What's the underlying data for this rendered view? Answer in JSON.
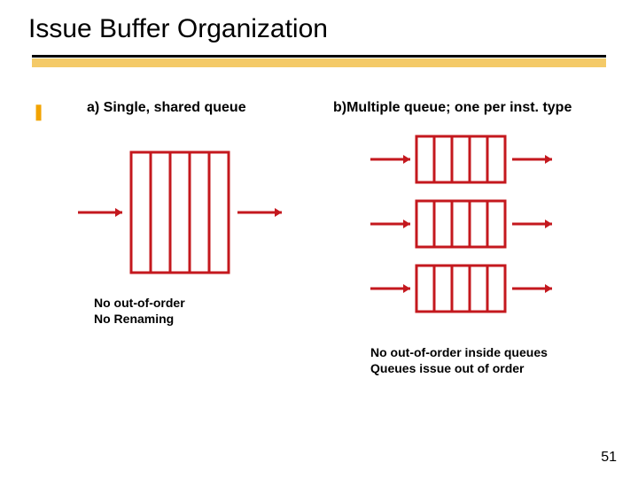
{
  "title": "Issue Buffer Organization",
  "bullet_glyph": "❚",
  "col_a": {
    "heading": "a) Single, shared queue",
    "caption_line1": "No out-of-order",
    "caption_line2": "No Renaming"
  },
  "col_b": {
    "heading": "b)Multiple queue; one per inst. type",
    "caption_line1": "No out-of-order inside queues",
    "caption_line2": "Queues issue out of order"
  },
  "page_number": "51",
  "colors": {
    "accent": "#c4181e",
    "rule": "#f2c14e"
  }
}
